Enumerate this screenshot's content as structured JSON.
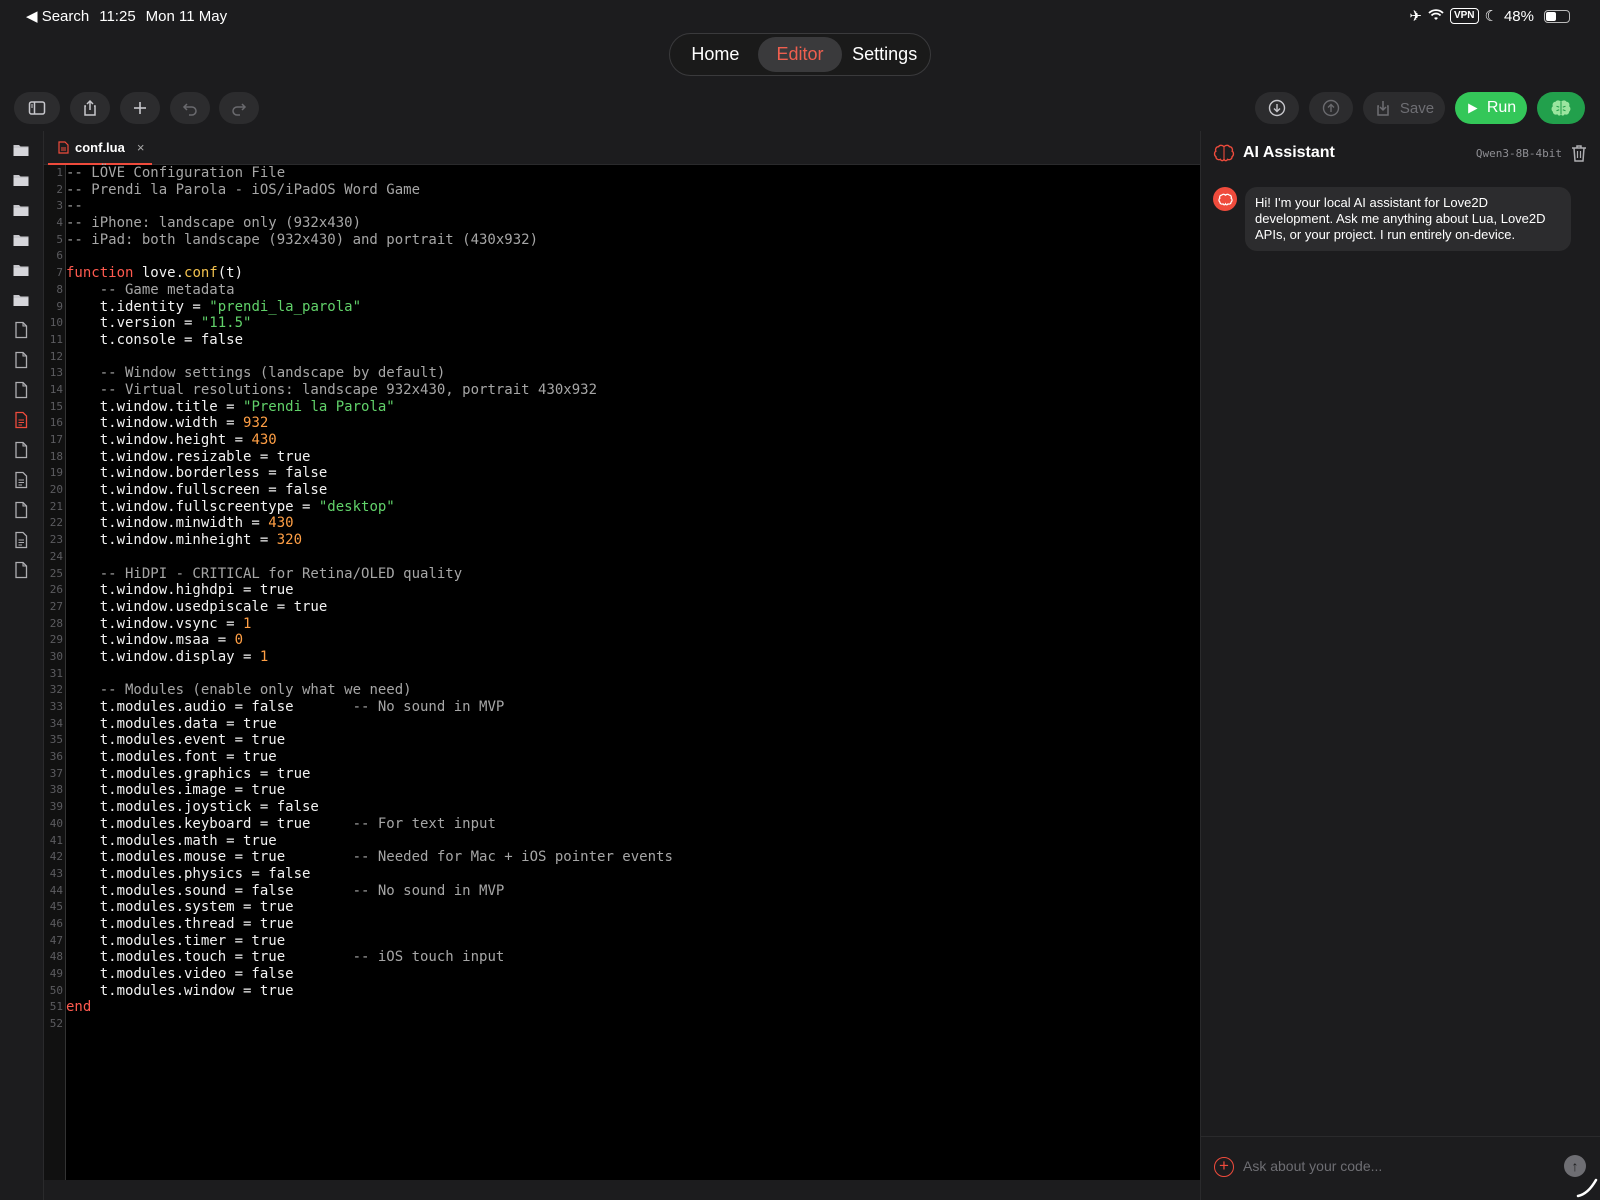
{
  "status": {
    "back_label": "◀ Search",
    "time": "11:25",
    "date": "Mon 11 May",
    "vpn": "VPN",
    "battery": "48%",
    "battery_level": 0.48
  },
  "nav": {
    "home": "Home",
    "editor": "Editor",
    "settings": "Settings"
  },
  "toolbar": {
    "save_label": "Save",
    "run_label": "Run"
  },
  "editor": {
    "tab_name": "conf.lua",
    "tab_close": "×"
  },
  "code_lines": [
    [
      [
        "c",
        "-- LÖVE Configuration File"
      ]
    ],
    [
      [
        "c",
        "-- Prendi la Parola - iOS/iPadOS Word Game"
      ]
    ],
    [
      [
        "c",
        "--"
      ]
    ],
    [
      [
        "c",
        "-- iPhone: landscape only (932x430)"
      ]
    ],
    [
      [
        "c",
        "-- iPad: both landscape (932x430) and portrait (430x932)"
      ]
    ],
    [],
    [
      [
        "k",
        "function"
      ],
      [
        "t",
        " love."
      ],
      [
        "f",
        "conf"
      ],
      [
        "t",
        "(t)"
      ]
    ],
    [
      [
        "t",
        "    "
      ],
      [
        "c",
        "-- Game metadata"
      ]
    ],
    [
      [
        "t",
        "    t.identity = "
      ],
      [
        "s",
        "\"prendi_la_parola\""
      ]
    ],
    [
      [
        "t",
        "    t.version = "
      ],
      [
        "s",
        "\"11.5\""
      ]
    ],
    [
      [
        "t",
        "    t.console = false"
      ]
    ],
    [],
    [
      [
        "t",
        "    "
      ],
      [
        "c",
        "-- Window settings (landscape by default)"
      ]
    ],
    [
      [
        "t",
        "    "
      ],
      [
        "c",
        "-- Virtual resolutions: landscape 932x430, portrait 430x932"
      ]
    ],
    [
      [
        "t",
        "    t.window.title = "
      ],
      [
        "s",
        "\"Prendi la Parola\""
      ]
    ],
    [
      [
        "t",
        "    t.window.width = "
      ],
      [
        "n",
        "932"
      ]
    ],
    [
      [
        "t",
        "    t.window.height = "
      ],
      [
        "n",
        "430"
      ]
    ],
    [
      [
        "t",
        "    t.window.resizable = true"
      ]
    ],
    [
      [
        "t",
        "    t.window.borderless = false"
      ]
    ],
    [
      [
        "t",
        "    t.window.fullscreen = false"
      ]
    ],
    [
      [
        "t",
        "    t.window.fullscreentype = "
      ],
      [
        "s",
        "\"desktop\""
      ]
    ],
    [
      [
        "t",
        "    t.window.minwidth = "
      ],
      [
        "n",
        "430"
      ]
    ],
    [
      [
        "t",
        "    t.window.minheight = "
      ],
      [
        "n",
        "320"
      ]
    ],
    [],
    [
      [
        "t",
        "    "
      ],
      [
        "c",
        "-- HiDPI - CRITICAL for Retina/OLED quality"
      ]
    ],
    [
      [
        "t",
        "    t.window.highdpi = true"
      ]
    ],
    [
      [
        "t",
        "    t.window.usedpiscale = true"
      ]
    ],
    [
      [
        "t",
        "    t.window.vsync = "
      ],
      [
        "n",
        "1"
      ]
    ],
    [
      [
        "t",
        "    t.window.msaa = "
      ],
      [
        "n",
        "0"
      ]
    ],
    [
      [
        "t",
        "    t.window.display = "
      ],
      [
        "n",
        "1"
      ]
    ],
    [],
    [
      [
        "t",
        "    "
      ],
      [
        "c",
        "-- Modules (enable only what we need)"
      ]
    ],
    [
      [
        "t",
        "    t.modules.audio = false       "
      ],
      [
        "c",
        "-- No sound in MVP"
      ]
    ],
    [
      [
        "t",
        "    t.modules.data = true"
      ]
    ],
    [
      [
        "t",
        "    t.modules.event = true"
      ]
    ],
    [
      [
        "t",
        "    t.modules.font = true"
      ]
    ],
    [
      [
        "t",
        "    t.modules.graphics = true"
      ]
    ],
    [
      [
        "t",
        "    t.modules.image = true"
      ]
    ],
    [
      [
        "t",
        "    t.modules.joystick = false"
      ]
    ],
    [
      [
        "t",
        "    t.modules.keyboard = true     "
      ],
      [
        "c",
        "-- For text input"
      ]
    ],
    [
      [
        "t",
        "    t.modules.math = true"
      ]
    ],
    [
      [
        "t",
        "    t.modules.mouse = true        "
      ],
      [
        "c",
        "-- Needed for Mac + iOS pointer events"
      ]
    ],
    [
      [
        "t",
        "    t.modules.physics = false"
      ]
    ],
    [
      [
        "t",
        "    t.modules.sound = false       "
      ],
      [
        "c",
        "-- No sound in MVP"
      ]
    ],
    [
      [
        "t",
        "    t.modules.system = true"
      ]
    ],
    [
      [
        "t",
        "    t.modules.thread = true"
      ]
    ],
    [
      [
        "t",
        "    t.modules.timer = true"
      ]
    ],
    [
      [
        "t",
        "    t.modules.touch = true        "
      ],
      [
        "c",
        "-- iOS touch input"
      ]
    ],
    [
      [
        "t",
        "    t.modules.video = false"
      ]
    ],
    [
      [
        "t",
        "    t.modules.window = true"
      ]
    ],
    [
      [
        "k",
        "end"
      ]
    ],
    []
  ],
  "ai": {
    "title": "AI Assistant",
    "model": "Qwen3-8B-4bit",
    "message": "Hi! I'm your local AI assistant for Love2D development. Ask me anything about Lua, Love2D APIs, or your project. I run entirely on-device.",
    "input_placeholder": "Ask about your code..."
  },
  "filebar_items": [
    "folder-icon",
    "folder-icon",
    "folder-icon",
    "folder-icon",
    "folder-icon",
    "folder-icon",
    "file-icon",
    "file-icon",
    "file-icon",
    "file-lua-active-icon",
    "file-icon",
    "file-text-icon",
    "file-icon",
    "file-text-icon",
    "file-icon"
  ],
  "colors": {
    "accent": "#ef4b3c",
    "run": "#34c759"
  }
}
